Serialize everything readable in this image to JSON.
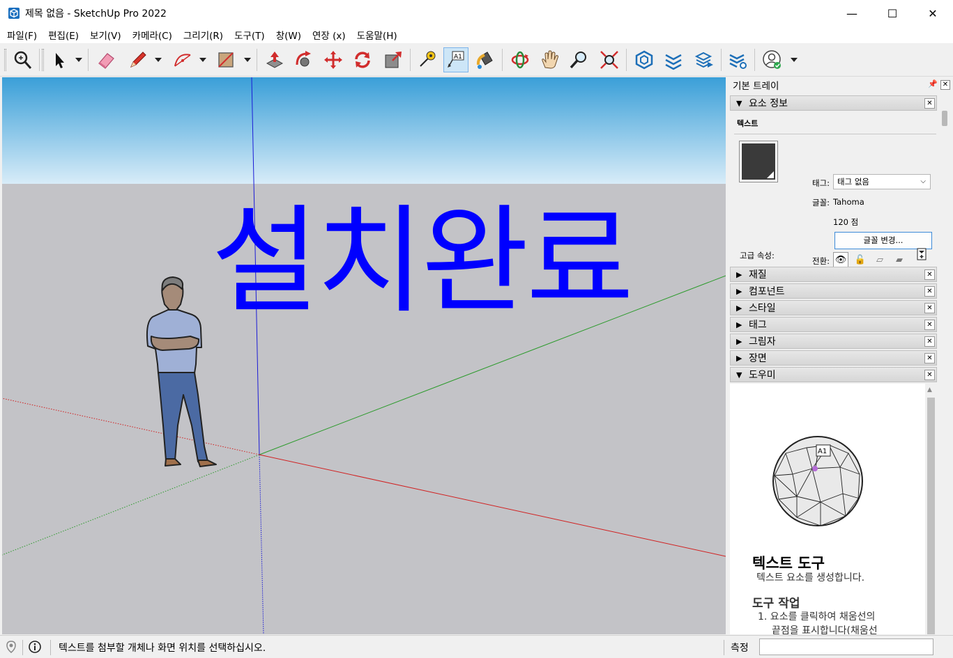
{
  "window": {
    "title": "제목 없음 - SketchUp Pro 2022",
    "minimize": "—",
    "maximize": "☐",
    "close": "✕"
  },
  "menu": [
    "파일(F)",
    "편집(E)",
    "보기(V)",
    "카메라(C)",
    "그리기(R)",
    "도구(T)",
    "창(W)",
    "연장 (x)",
    "도움말(H)"
  ],
  "viewport": {
    "text": "설치완료",
    "text_color": "#0000ff",
    "sky_top": "#3a9fd8",
    "ground": "#c3c3c7"
  },
  "tray": {
    "title": "기본 트레이",
    "entity_info": {
      "header": "요소 정보",
      "kind": "텍스트",
      "tag_label": "태그:",
      "tag_value": "태그 없음",
      "font_label": "글꼴:",
      "font_value": "Tahoma",
      "size_value": "120 점",
      "change_font_button": "글꼴 변경...",
      "toggle_label": "전환:",
      "advanced_label": "고급 속성:"
    },
    "panels": [
      "재질",
      "컴포넌트",
      "스타일",
      "태그",
      "그림자",
      "장면"
    ],
    "help": {
      "header": "도우미",
      "badge": "A1",
      "title": "텍스트 도구",
      "description": "텍스트 요소를 생성합니다.",
      "section": "도구 작업",
      "step1_a": "1. 요소를 클릭하여 채움선의",
      "step1_b": "끝점을 표시합니다(채움선"
    }
  },
  "status": {
    "message": "텍스트를 첨부할 개체나 화면 위치를 선택하십시오.",
    "measure_label": "측정",
    "measure_value": ""
  },
  "toolbar": {
    "text_tool_badge": "A1"
  }
}
